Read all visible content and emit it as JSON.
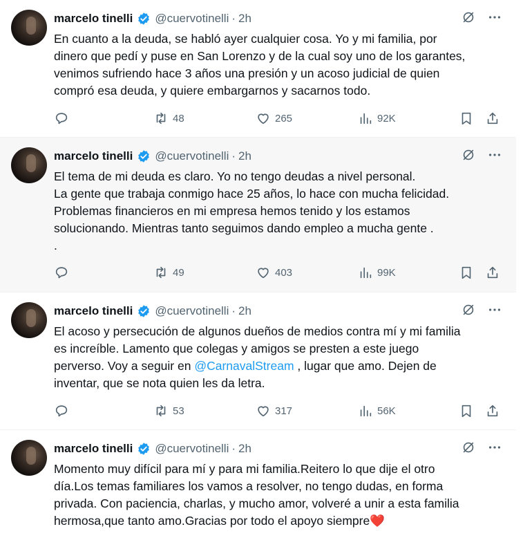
{
  "tweets": [
    {
      "name": "marcelo tinelli",
      "handle": "@cuervotinelli",
      "dot": "·",
      "time": "2h",
      "text": "En cuanto a la deuda, se habló ayer cualquier cosa. Yo y mi familia, por\ndinero que pedí y puse en San Lorenzo y de la cual soy uno de los garantes,\nvenimos sufriendo hace 3 años una presión y un acoso judicial de quien\ncompró esa deuda, y quiere embargarnos y sacarnos todo.",
      "retweets": "48",
      "likes": "265",
      "views": "92K"
    },
    {
      "name": "marcelo tinelli",
      "handle": "@cuervotinelli",
      "dot": "·",
      "time": "2h",
      "text": "El tema de mi deuda es claro. Yo no tengo deudas a nivel personal.\nLa gente que trabaja conmigo hace 25 años, lo  hace con mucha felicidad.\nProblemas financieros en  mi empresa hemos tenido y los estamos\nsolucionando. Mientras tanto seguimos  dando empleo a mucha gente .\n.",
      "retweets": "49",
      "likes": "403",
      "views": "99K"
    },
    {
      "name": "marcelo tinelli",
      "handle": "@cuervotinelli",
      "dot": "·",
      "time": "2h",
      "text_before": "El acoso y persecución de algunos dueños de medios contra mí y mi familia\nes increíble. Lamento que colegas y amigos se presten a este juego\nperverso. Voy a seguir en ",
      "mention": "@CarnavalStream",
      "text_after": " , lugar que amo. Dejen de\ninventar, que se nota quien les da letra.",
      "retweets": "53",
      "likes": "317",
      "views": "56K"
    },
    {
      "name": "marcelo tinelli",
      "handle": "@cuervotinelli",
      "dot": "·",
      "time": "2h",
      "text": "Momento muy difícil para mí y para mi familia.Reitero lo que dije el otro\ndía.Los temas familiares los vamos a resolver, no tengo dudas, en forma\nprivada. Con paciencia, charlas, y mucho amor, volveré a unir a esta familia\nhermosa,que tanto amo.Gracias por todo el apoyo siempre",
      "emoji": "❤️"
    }
  ],
  "icons": {
    "verified": "verified-badge-icon",
    "grok": "grok-icon",
    "more": "more-icon",
    "reply": "reply-icon",
    "retweet": "retweet-icon",
    "like": "heart-icon",
    "views": "views-icon",
    "bookmark": "bookmark-icon",
    "share": "share-icon"
  },
  "colors": {
    "verified": "#1d9bf0",
    "link": "#1d9bf0",
    "secondary_text": "#536471",
    "highlight_bg": "#f7f7f7"
  }
}
